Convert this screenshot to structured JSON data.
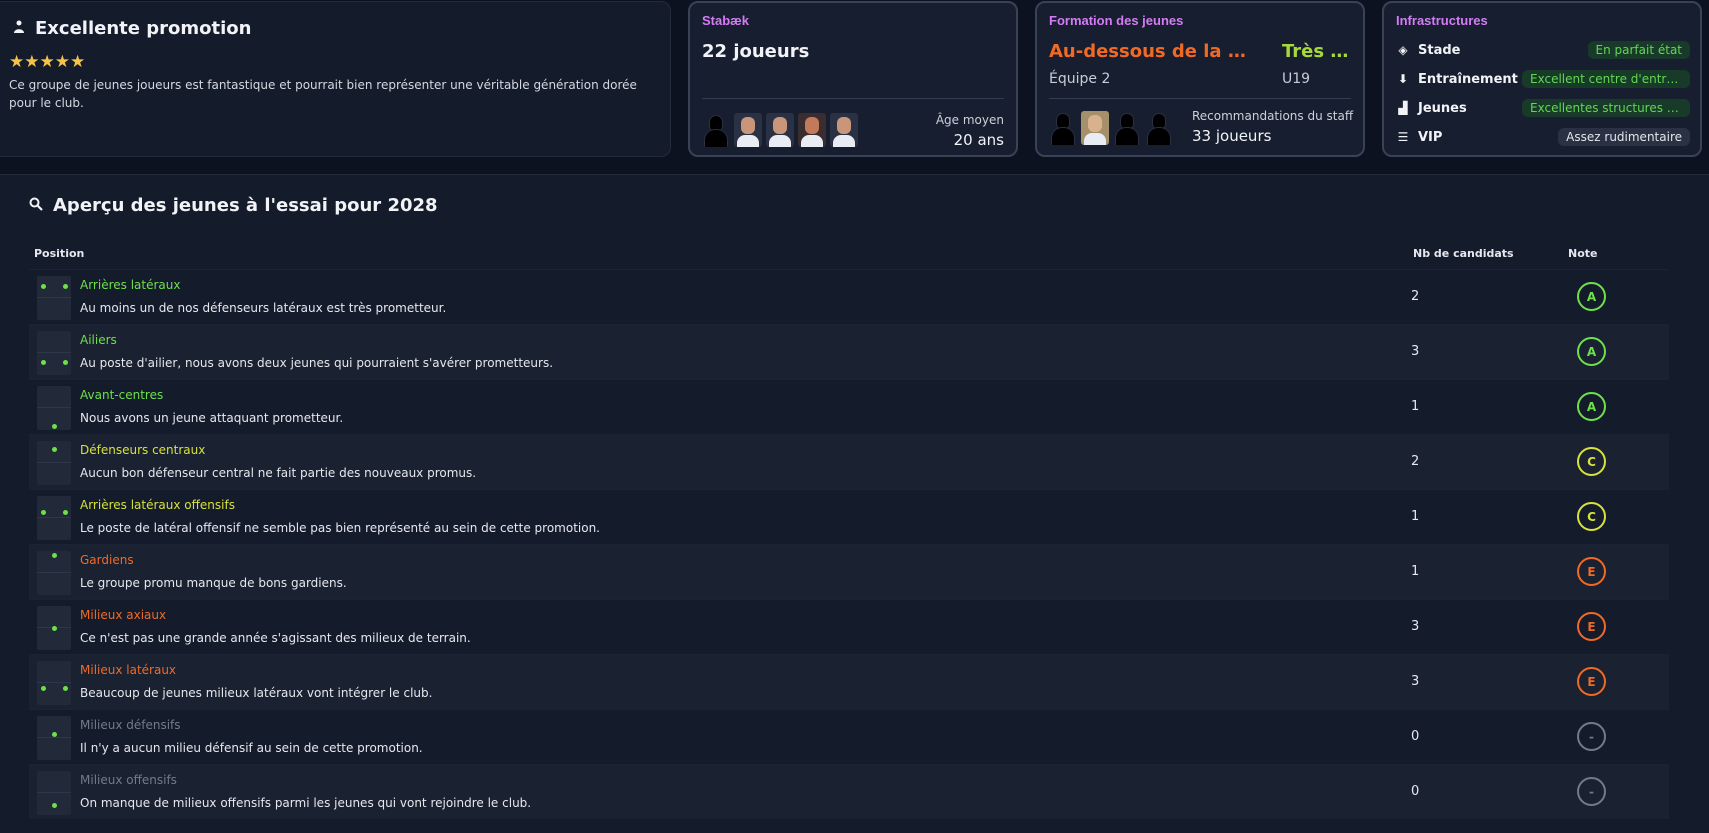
{
  "promo": {
    "title": "Excellente promotion",
    "icon": "person-icon",
    "stars": "★★★★★",
    "description": "Ce groupe de jeunes joueurs est fantastique et pourrait bien représenter une véritable génération dorée pour le club."
  },
  "club": {
    "label": "Stabæk",
    "players": "22 joueurs",
    "age_label": "Âge moyen",
    "age_value": "20 ans"
  },
  "youth": {
    "label": "Formation des jeunes",
    "level1": "Au-dessous de la moyenne",
    "level2": "Très faible",
    "team1": "Équipe 2",
    "team2": "U19",
    "rec_label": "Recommandations du staff",
    "rec_value": "33 joueurs"
  },
  "infra": {
    "label": "Infrastructures",
    "items": [
      {
        "label": "Stade",
        "icon": "stadium-icon",
        "value": "En parfait état",
        "color": "green"
      },
      {
        "label": "Entraînement",
        "icon": "training-icon",
        "value": "Excellent centre d'entraînement",
        "color": "green"
      },
      {
        "label": "Jeunes",
        "icon": "youth-icon",
        "value": "Excellentes structures de jeunes",
        "color": "green"
      },
      {
        "label": "VIP",
        "icon": "vip-icon",
        "value": "Assez rudimentaire",
        "color": "grey"
      }
    ]
  },
  "preview": {
    "title": "Aperçu des jeunes à l'essai pour 2028",
    "icon": "search-icon",
    "columns": {
      "position": "Position",
      "count": "Nb de candidats",
      "grade": "Note"
    },
    "rows": [
      {
        "name": "Arrières latéraux",
        "desc": "Au moins un de nos défenseurs latéraux est très prometteur.",
        "count": "2",
        "grade": "A",
        "tone": "green"
      },
      {
        "name": "Ailiers",
        "desc": "Au poste d'ailier, nous avons deux jeunes qui pourraient s'avérer prometteurs.",
        "count": "3",
        "grade": "A",
        "tone": "green"
      },
      {
        "name": "Avant-centres",
        "desc": "Nous avons un jeune attaquant prometteur.",
        "count": "1",
        "grade": "A",
        "tone": "green"
      },
      {
        "name": "Défenseurs centraux",
        "desc": "Aucun bon défenseur central ne fait partie des nouveaux promus.",
        "count": "2",
        "grade": "C",
        "tone": "yellow"
      },
      {
        "name": "Arrières latéraux offensifs",
        "desc": "Le poste de latéral offensif ne semble pas bien représenté au sein de cette promotion.",
        "count": "1",
        "grade": "C",
        "tone": "yellow"
      },
      {
        "name": "Gardiens",
        "desc": "Le groupe promu manque de bons gardiens.",
        "count": "1",
        "grade": "E",
        "tone": "orange"
      },
      {
        "name": "Milieux axiaux",
        "desc": "Ce n'est pas une grande année s'agissant des milieux de terrain.",
        "count": "3",
        "grade": "E",
        "tone": "orange"
      },
      {
        "name": "Milieux latéraux",
        "desc": "Beaucoup de jeunes milieux latéraux vont intégrer le club.",
        "count": "3",
        "grade": "E",
        "tone": "orange"
      },
      {
        "name": "Milieux défensifs",
        "desc": "Il n'y a aucun milieu défensif au sein de cette promotion.",
        "count": "0",
        "grade": "-",
        "tone": "grey"
      },
      {
        "name": "Milieux offensifs",
        "desc": "On manque de milieux offensifs parmi les jeunes qui vont rejoindre le club.",
        "count": "0",
        "grade": "-",
        "tone": "grey"
      }
    ]
  }
}
